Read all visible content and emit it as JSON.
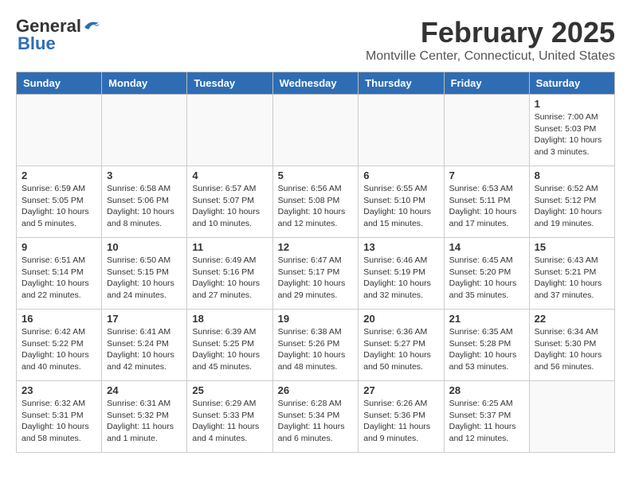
{
  "header": {
    "logo_general": "General",
    "logo_blue": "Blue",
    "month_title": "February 2025",
    "location": "Montville Center, Connecticut, United States"
  },
  "weekdays": [
    "Sunday",
    "Monday",
    "Tuesday",
    "Wednesday",
    "Thursday",
    "Friday",
    "Saturday"
  ],
  "weeks": [
    [
      {
        "day": "",
        "info": ""
      },
      {
        "day": "",
        "info": ""
      },
      {
        "day": "",
        "info": ""
      },
      {
        "day": "",
        "info": ""
      },
      {
        "day": "",
        "info": ""
      },
      {
        "day": "",
        "info": ""
      },
      {
        "day": "1",
        "info": "Sunrise: 7:00 AM\nSunset: 5:03 PM\nDaylight: 10 hours\nand 3 minutes."
      }
    ],
    [
      {
        "day": "2",
        "info": "Sunrise: 6:59 AM\nSunset: 5:05 PM\nDaylight: 10 hours\nand 5 minutes."
      },
      {
        "day": "3",
        "info": "Sunrise: 6:58 AM\nSunset: 5:06 PM\nDaylight: 10 hours\nand 8 minutes."
      },
      {
        "day": "4",
        "info": "Sunrise: 6:57 AM\nSunset: 5:07 PM\nDaylight: 10 hours\nand 10 minutes."
      },
      {
        "day": "5",
        "info": "Sunrise: 6:56 AM\nSunset: 5:08 PM\nDaylight: 10 hours\nand 12 minutes."
      },
      {
        "day": "6",
        "info": "Sunrise: 6:55 AM\nSunset: 5:10 PM\nDaylight: 10 hours\nand 15 minutes."
      },
      {
        "day": "7",
        "info": "Sunrise: 6:53 AM\nSunset: 5:11 PM\nDaylight: 10 hours\nand 17 minutes."
      },
      {
        "day": "8",
        "info": "Sunrise: 6:52 AM\nSunset: 5:12 PM\nDaylight: 10 hours\nand 19 minutes."
      }
    ],
    [
      {
        "day": "9",
        "info": "Sunrise: 6:51 AM\nSunset: 5:14 PM\nDaylight: 10 hours\nand 22 minutes."
      },
      {
        "day": "10",
        "info": "Sunrise: 6:50 AM\nSunset: 5:15 PM\nDaylight: 10 hours\nand 24 minutes."
      },
      {
        "day": "11",
        "info": "Sunrise: 6:49 AM\nSunset: 5:16 PM\nDaylight: 10 hours\nand 27 minutes."
      },
      {
        "day": "12",
        "info": "Sunrise: 6:47 AM\nSunset: 5:17 PM\nDaylight: 10 hours\nand 29 minutes."
      },
      {
        "day": "13",
        "info": "Sunrise: 6:46 AM\nSunset: 5:19 PM\nDaylight: 10 hours\nand 32 minutes."
      },
      {
        "day": "14",
        "info": "Sunrise: 6:45 AM\nSunset: 5:20 PM\nDaylight: 10 hours\nand 35 minutes."
      },
      {
        "day": "15",
        "info": "Sunrise: 6:43 AM\nSunset: 5:21 PM\nDaylight: 10 hours\nand 37 minutes."
      }
    ],
    [
      {
        "day": "16",
        "info": "Sunrise: 6:42 AM\nSunset: 5:22 PM\nDaylight: 10 hours\nand 40 minutes."
      },
      {
        "day": "17",
        "info": "Sunrise: 6:41 AM\nSunset: 5:24 PM\nDaylight: 10 hours\nand 42 minutes."
      },
      {
        "day": "18",
        "info": "Sunrise: 6:39 AM\nSunset: 5:25 PM\nDaylight: 10 hours\nand 45 minutes."
      },
      {
        "day": "19",
        "info": "Sunrise: 6:38 AM\nSunset: 5:26 PM\nDaylight: 10 hours\nand 48 minutes."
      },
      {
        "day": "20",
        "info": "Sunrise: 6:36 AM\nSunset: 5:27 PM\nDaylight: 10 hours\nand 50 minutes."
      },
      {
        "day": "21",
        "info": "Sunrise: 6:35 AM\nSunset: 5:28 PM\nDaylight: 10 hours\nand 53 minutes."
      },
      {
        "day": "22",
        "info": "Sunrise: 6:34 AM\nSunset: 5:30 PM\nDaylight: 10 hours\nand 56 minutes."
      }
    ],
    [
      {
        "day": "23",
        "info": "Sunrise: 6:32 AM\nSunset: 5:31 PM\nDaylight: 10 hours\nand 58 minutes."
      },
      {
        "day": "24",
        "info": "Sunrise: 6:31 AM\nSunset: 5:32 PM\nDaylight: 11 hours\nand 1 minute."
      },
      {
        "day": "25",
        "info": "Sunrise: 6:29 AM\nSunset: 5:33 PM\nDaylight: 11 hours\nand 4 minutes."
      },
      {
        "day": "26",
        "info": "Sunrise: 6:28 AM\nSunset: 5:34 PM\nDaylight: 11 hours\nand 6 minutes."
      },
      {
        "day": "27",
        "info": "Sunrise: 6:26 AM\nSunset: 5:36 PM\nDaylight: 11 hours\nand 9 minutes."
      },
      {
        "day": "28",
        "info": "Sunrise: 6:25 AM\nSunset: 5:37 PM\nDaylight: 11 hours\nand 12 minutes."
      },
      {
        "day": "",
        "info": ""
      }
    ]
  ]
}
